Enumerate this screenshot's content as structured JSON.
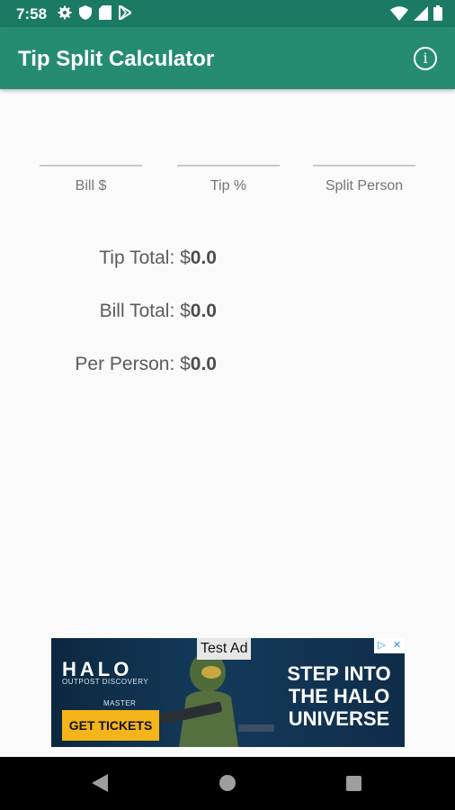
{
  "status_bar": {
    "time": "7:58",
    "left_icons": [
      "gear-icon",
      "shield-icon",
      "sd-card-icon",
      "play-store-icon"
    ],
    "right_icons": [
      "wifi-icon",
      "cellular-signal-icon",
      "battery-icon"
    ]
  },
  "app_bar": {
    "title": "Tip Split Calculator",
    "info_icon": "info-icon",
    "info_glyph": "i",
    "color": "#268c71"
  },
  "inputs": {
    "bill": {
      "label": "Bill $",
      "value": ""
    },
    "tip": {
      "label": "Tip %",
      "value": ""
    },
    "split": {
      "label": "Split Person",
      "value": ""
    }
  },
  "results": {
    "tip_total": {
      "label": "Tip Total: $",
      "value": "0.0"
    },
    "bill_total": {
      "label": "Bill Total: $",
      "value": "0.0"
    },
    "per_person": {
      "label": "Per Person: $",
      "value": "0.0"
    }
  },
  "ad": {
    "badge": "Test Ad",
    "brand": "HALO",
    "subtitle": "OUTPOST DISCOVERY",
    "tag": "MASTER",
    "cta": "GET TICKETS",
    "headline": "STEP INTO THE HALO UNIVERSE",
    "choice_icons": [
      "ad-choices-icon",
      "close-icon"
    ],
    "choice_glyphs": [
      "▷",
      "✕"
    ]
  },
  "nav_bar": {
    "icons": [
      "back-icon",
      "home-icon",
      "recents-icon"
    ]
  }
}
